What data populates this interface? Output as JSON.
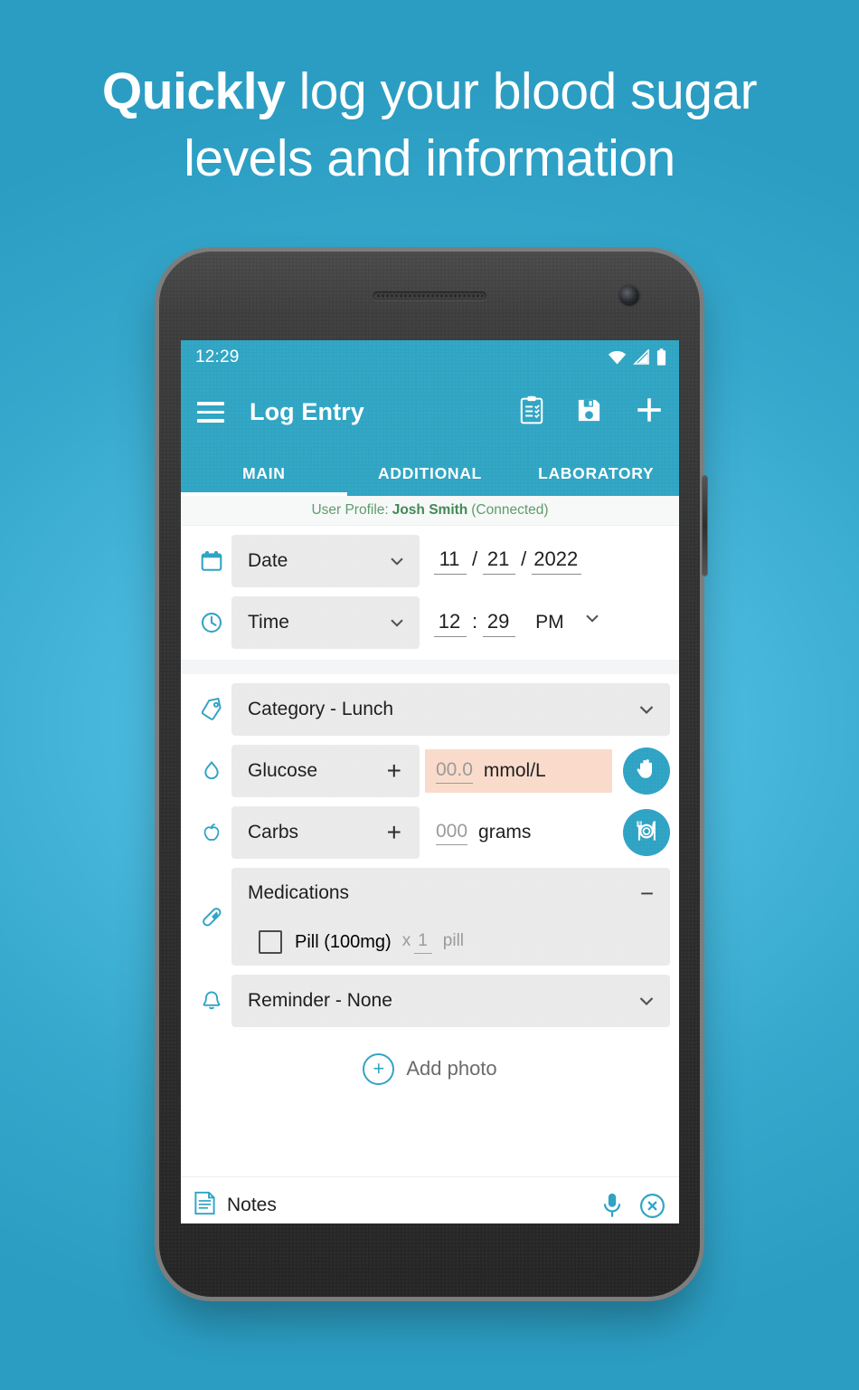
{
  "promo": {
    "headline_strong": "Quickly",
    "headline_rest": " log your blood sugar",
    "headline_line2": "levels and information",
    "bg_color": "#35A8CC"
  },
  "phone": {
    "status": {
      "clock": "12:29",
      "icons": [
        "wifi-icon",
        "cellular-signal-icon",
        "battery-icon"
      ]
    },
    "appbar": {
      "menu_icon": "hamburger-menu-icon",
      "title": "Log Entry",
      "actions": [
        {
          "icon": "clipboard-checklist-icon",
          "name": "log-list-button"
        },
        {
          "icon": "floppy-save-icon",
          "name": "save-button"
        },
        {
          "icon": "plus-icon",
          "name": "add-entry-button"
        }
      ]
    },
    "tabs": [
      {
        "label": "MAIN",
        "active": true
      },
      {
        "label": "ADDITIONAL",
        "active": false
      },
      {
        "label": "LABORATORY",
        "active": false
      }
    ],
    "profile": {
      "prefix": "User Profile:",
      "name": "Josh Smith",
      "status": "(Connected)",
      "color": "#5C9B6B"
    },
    "form": {
      "date": {
        "icon": "calendar-icon",
        "label": "Date",
        "month": "11",
        "day": "21",
        "year": "2022",
        "slash": "/"
      },
      "time": {
        "icon": "clock-icon",
        "label": "Time",
        "hour": "12",
        "minute": "29",
        "colon": ":",
        "meridiem": "PM"
      },
      "category": {
        "icon": "tag-icon",
        "label": "Category - Lunch"
      },
      "glucose": {
        "icon": "blood-drop-icon",
        "label": "Glucose",
        "plus": "+",
        "value_placeholder": "00.0",
        "unit": "mmol/L",
        "action_icon": "hand-stop-icon",
        "field_bg": "#FADBCB"
      },
      "carbs": {
        "icon": "apple-icon",
        "label": "Carbs",
        "plus": "+",
        "value_placeholder": "000",
        "unit": "grams",
        "action_icon": "plate-cutlery-icon"
      },
      "medications": {
        "icon": "pill-capsule-icon",
        "label": "Medications",
        "collapse": "−",
        "items": [
          {
            "name": "Pill (100mg)",
            "multiplier": "x",
            "quantity": "1",
            "unit": "pill",
            "checked": false
          }
        ]
      },
      "reminder": {
        "icon": "bell-icon",
        "label": "Reminder - None"
      },
      "add_photo": {
        "icon": "circle-plus-icon",
        "label": "Add photo"
      },
      "notes": {
        "icon": "notes-document-icon",
        "label": "Notes",
        "mic_icon": "microphone-icon",
        "clear_icon": "circle-x-icon"
      }
    },
    "theme": {
      "accent": "#30A5C3",
      "field_bg": "#EAEAEA",
      "highlight": "#FADBCB"
    }
  }
}
